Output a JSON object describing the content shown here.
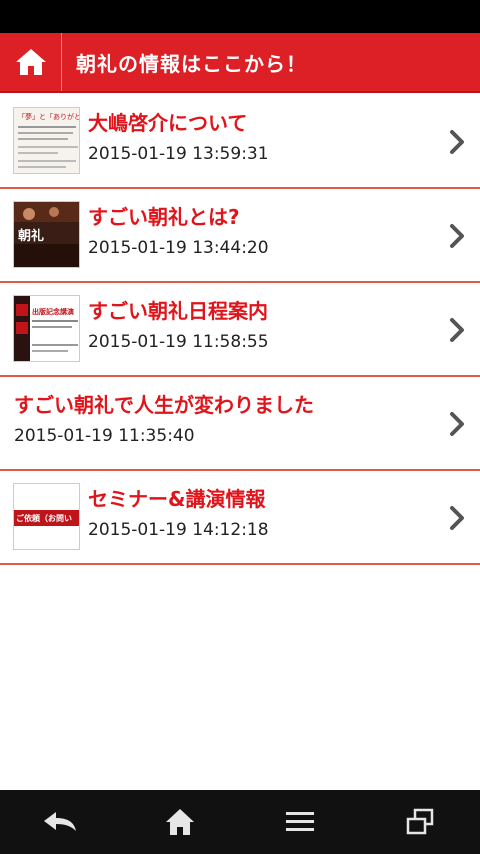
{
  "header": {
    "title": "朝礼の情報はここから！",
    "home_icon": "home-icon"
  },
  "items": [
    {
      "title": "大嶋啓介について",
      "time": "2015-01-19 13:59:31",
      "has_thumb": true,
      "thumb_text": "「夢」と「ありがとう」"
    },
    {
      "title": "すごい朝礼とは?",
      "time": "2015-01-19 13:44:20",
      "has_thumb": true,
      "thumb_text": "朝礼"
    },
    {
      "title": "すごい朝礼日程案内",
      "time": "2015-01-19 11:58:55",
      "has_thumb": true,
      "thumb_text": "出版記念講演"
    },
    {
      "title": "すごい朝礼で人生が変わりました",
      "time": "2015-01-19 11:35:40",
      "has_thumb": false
    },
    {
      "title": "セミナー&講演情報",
      "time": "2015-01-19 14:12:18",
      "has_thumb": true,
      "thumb_text": "ご依頼（お問い"
    }
  ],
  "bottom_nav": [
    "back-icon",
    "home-icon",
    "menu-icon",
    "windows-icon"
  ],
  "colors": {
    "brand_red": "#dd1f26",
    "title_red": "#e0141b",
    "divider": "#e05a4a"
  }
}
